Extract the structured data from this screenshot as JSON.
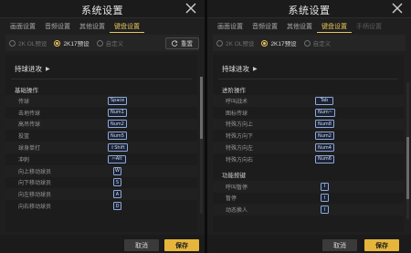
{
  "dialog_title": "系统设置",
  "tabs": [
    {
      "label": "画面设置"
    },
    {
      "label": "音频设置"
    },
    {
      "label": "其他设置"
    },
    {
      "label": "键盘设置"
    },
    {
      "label": "手柄设置"
    }
  ],
  "active_tab": "键盘设置",
  "presets": [
    "2K OL预设",
    "2K17预设",
    "自定义"
  ],
  "selected_preset": "2K17预设",
  "reset_label": "重置",
  "section_title": "持球进攻",
  "left": {
    "group": "基础操作",
    "rows": [
      {
        "label": "传球",
        "key": "Space"
      },
      {
        "label": "击地传球",
        "key": "Num1"
      },
      {
        "label": "高吊传球",
        "key": "Num2"
      },
      {
        "label": "投篮",
        "key": "Num5"
      },
      {
        "label": "球身单打",
        "key": "⇧Shift"
      },
      {
        "label": "冲刺",
        "key": "⇦Alt"
      },
      {
        "label": "向上移动球员",
        "key": "W"
      },
      {
        "label": "向下移动球员",
        "key": "S"
      },
      {
        "label": "向左移动球员",
        "key": "A"
      },
      {
        "label": "向右移动球员",
        "key": "D"
      }
    ]
  },
  "right": {
    "group": "进阶操作",
    "rows": [
      {
        "label": "呼叫战术",
        "key": "Tab"
      },
      {
        "label": "图标传球",
        "key": "Num~"
      },
      {
        "label": "特殊方向上",
        "key": "Num8"
      },
      {
        "label": "特殊方向下",
        "key": "Num2"
      },
      {
        "label": "特殊方向左",
        "key": "Num4"
      },
      {
        "label": "特殊方向右",
        "key": "Num6"
      }
    ],
    "group2": "功能按键",
    "rows2": [
      {
        "label": "呼叫暂停",
        "key": "I"
      },
      {
        "label": "暂停",
        "key": "I"
      },
      {
        "label": "动态换人",
        "key": "I"
      }
    ]
  },
  "cancel_label": "取消",
  "save_label": "保存",
  "colors": {
    "accent": "#e5b53c",
    "keybox_border": "#8fa9d8"
  }
}
